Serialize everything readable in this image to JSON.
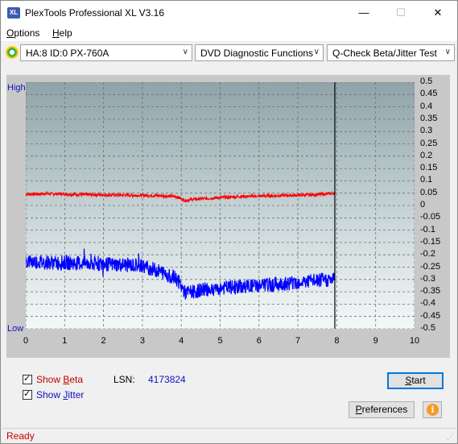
{
  "window": {
    "title": "PlexTools Professional XL V3.16",
    "icon_text": "XL"
  },
  "menu": {
    "items": [
      {
        "label": "Options",
        "ul": "O",
        "rest": "ptions"
      },
      {
        "label": "Help",
        "ul": "H",
        "rest": "elp"
      }
    ]
  },
  "toolbar": {
    "drive_select": "HA:8 ID:0  PX-760A",
    "function_select": "DVD Diagnostic Functions",
    "test_select": "Q-Check Beta/Jitter Test"
  },
  "chart_data": {
    "type": "line",
    "left_axis_labels": {
      "top": "High",
      "bottom": "Low"
    },
    "x_ticks": [
      "0",
      "1",
      "2",
      "3",
      "4",
      "5",
      "6",
      "7",
      "8",
      "9",
      "10"
    ],
    "y_ticks": [
      "0.5",
      "0.45",
      "0.4",
      "0.35",
      "0.3",
      "0.25",
      "0.2",
      "0.15",
      "0.1",
      "0.05",
      "0",
      "-0.05",
      "-0.1",
      "-0.15",
      "-0.2",
      "-0.25",
      "-0.3",
      "-0.35",
      "-0.4",
      "-0.45",
      "-0.5"
    ],
    "xlim": [
      0,
      10
    ],
    "ylim": [
      -0.5,
      0.5
    ],
    "grid": true,
    "end_marker_x": 7.95,
    "series": [
      {
        "color": "#ff0000",
        "x": [
          0,
          0.5,
          1,
          1.5,
          2,
          2.5,
          3,
          3.5,
          3.9,
          4.1,
          4.3,
          4.6,
          5,
          5.5,
          6,
          6.5,
          7,
          7.5,
          7.95
        ],
        "values": [
          0.045,
          0.048,
          0.046,
          0.044,
          0.043,
          0.042,
          0.041,
          0.04,
          0.035,
          0.02,
          0.025,
          0.028,
          0.032,
          0.036,
          0.038,
          0.04,
          0.042,
          0.044,
          0.05
        ]
      },
      {
        "color": "#0000ff",
        "x": [
          0,
          0.5,
          1,
          1.5,
          2,
          2.5,
          3,
          3.5,
          3.9,
          4.1,
          4.3,
          4.6,
          5,
          5.5,
          6,
          6.5,
          7,
          7.5,
          7.95
        ],
        "values": [
          -0.225,
          -0.23,
          -0.232,
          -0.235,
          -0.238,
          -0.24,
          -0.245,
          -0.27,
          -0.3,
          -0.355,
          -0.35,
          -0.34,
          -0.335,
          -0.33,
          -0.325,
          -0.32,
          -0.31,
          -0.305,
          -0.3
        ]
      }
    ]
  },
  "options": {
    "show_beta_label": "Show Beta",
    "show_beta_ul": "B",
    "show_beta_pre": "Show ",
    "show_beta_post": "eta",
    "show_jitter_pre": "Show ",
    "show_jitter_ul": "J",
    "show_jitter_post": "itter",
    "show_beta_color": "#c00000",
    "show_jitter_color": "#1010c0",
    "lsn_label": "LSN:",
    "lsn_value": "4173824",
    "start_pre": "",
    "start_ul": "S",
    "start_post": "tart",
    "prefs_pre": "",
    "prefs_ul": "P",
    "prefs_post": "references",
    "info_label": "i"
  },
  "status": {
    "text": "Ready"
  }
}
